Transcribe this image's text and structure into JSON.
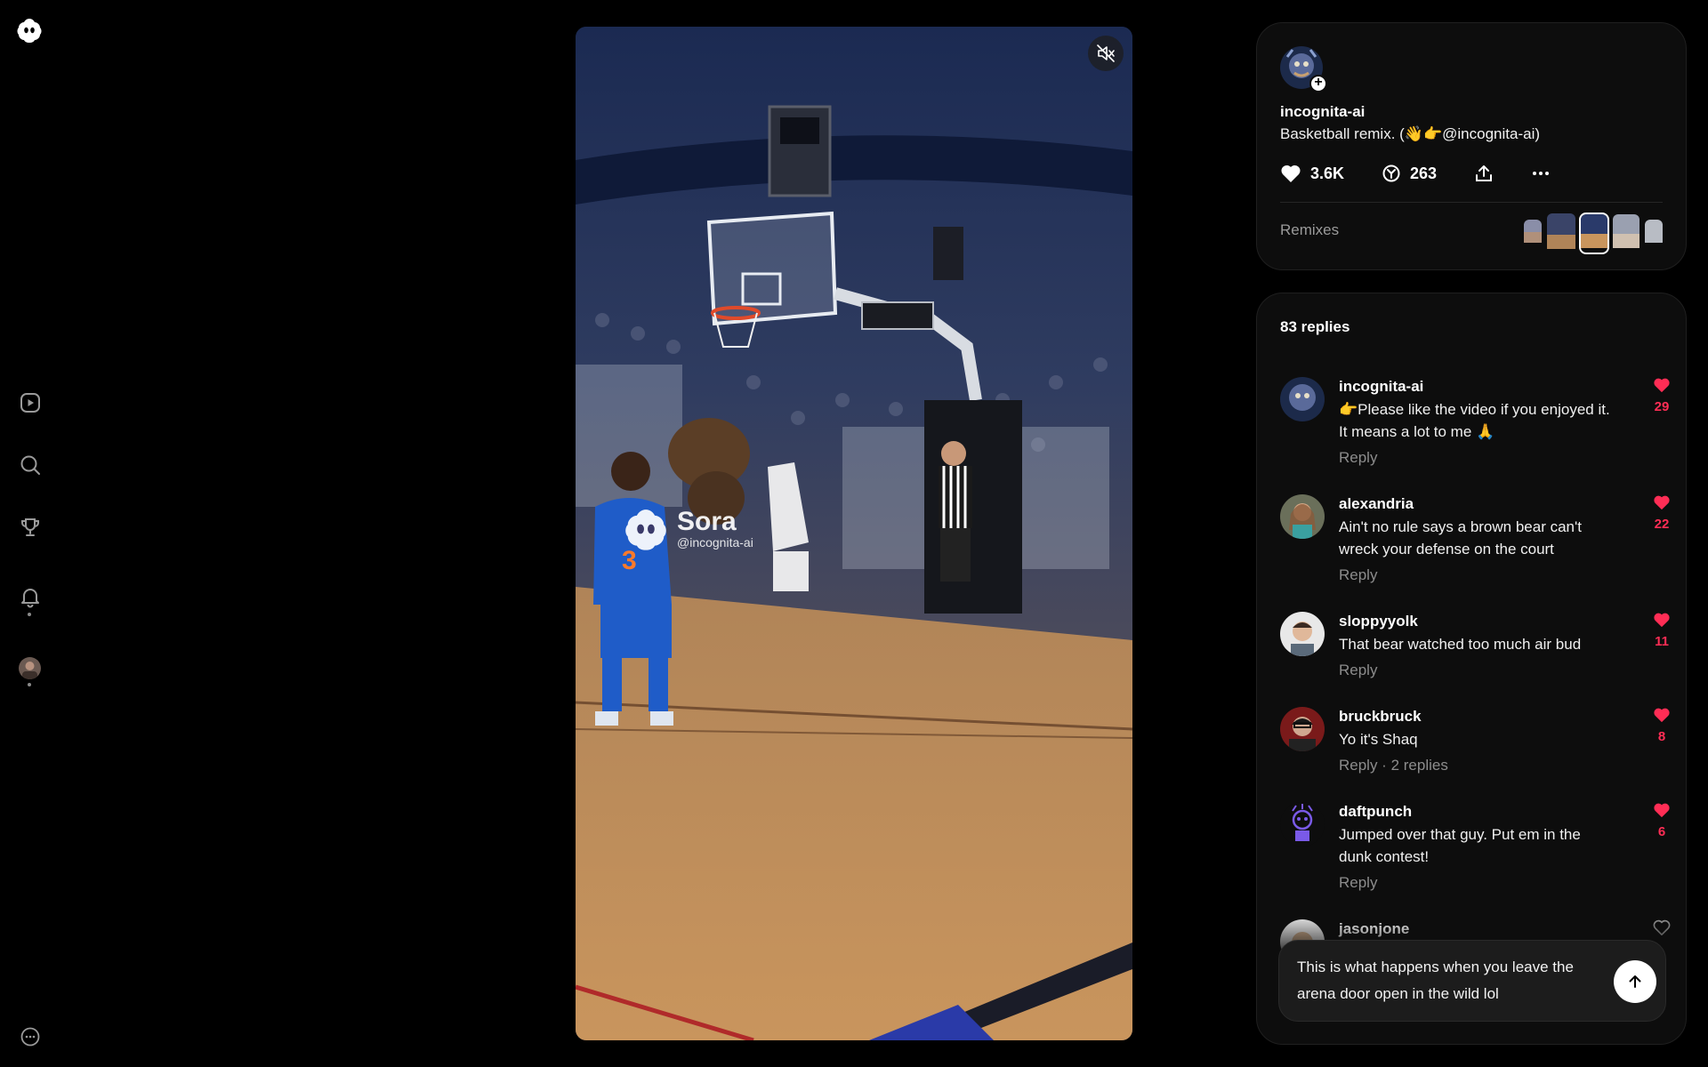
{
  "app": {
    "logo_icon": "sora-logo"
  },
  "sidebar": {
    "items": [
      {
        "name": "feed",
        "icon": "play-square-icon"
      },
      {
        "name": "search",
        "icon": "search-icon"
      },
      {
        "name": "leaderboard",
        "icon": "trophy-icon"
      },
      {
        "name": "notifications",
        "icon": "bell-icon"
      },
      {
        "name": "profile",
        "icon": "avatar"
      }
    ],
    "more_icon": "more-circle-icon"
  },
  "video": {
    "watermark_brand": "Sora",
    "watermark_handle": "@incognita-ai",
    "mute_icon": "speaker-muted-icon"
  },
  "post": {
    "username": "incognita-ai",
    "caption": "Basketball remix. (👋👉@incognita-ai)",
    "likes": "3.6K",
    "remixes_count": "263",
    "remixes_label": "Remixes"
  },
  "replies": {
    "title": "83 replies",
    "items": [
      {
        "user": "incognita-ai",
        "text": "👉Please like the video if you enjoyed it. It means a lot to me 🙏",
        "reply": "Reply",
        "likes": "29",
        "liked": true
      },
      {
        "user": "alexandria",
        "text": "Ain't no rule says a brown bear can't wreck your defense on the court",
        "reply": "Reply",
        "likes": "22",
        "liked": true
      },
      {
        "user": "sloppyyolk",
        "text": "That bear watched too much air bud",
        "reply": "Reply",
        "likes": "11",
        "liked": true
      },
      {
        "user": "bruckbruck",
        "text": "Yo it's Shaq",
        "reply": "Reply · 2 replies",
        "likes": "8",
        "liked": true
      },
      {
        "user": "daftpunch",
        "text": "Jumped over that guy. Put em in the dunk contest!",
        "reply": "Reply",
        "likes": "6",
        "liked": true
      },
      {
        "user": "jasonjone",
        "text": "",
        "reply": "",
        "likes": "",
        "liked": false
      }
    ]
  },
  "composer": {
    "value": "This is what happens when you leave the arena door open in the wild lol"
  },
  "colors": {
    "like": "#ff2d55",
    "background": "#000000",
    "card": "#0d0d0d"
  }
}
